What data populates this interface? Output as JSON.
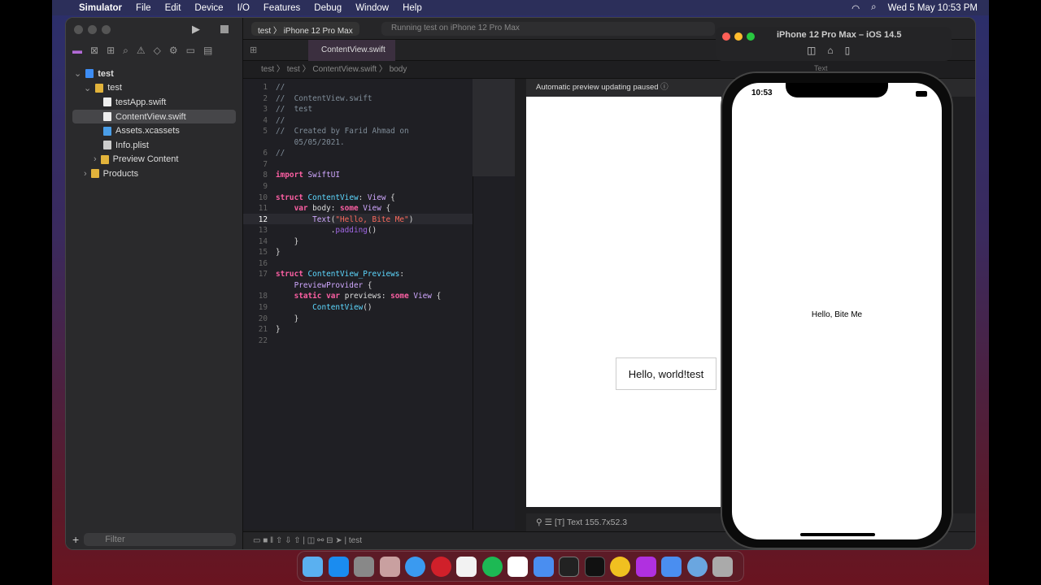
{
  "menubar": {
    "app": "Simulator",
    "items": [
      "File",
      "Edit",
      "Device",
      "I/O",
      "Features",
      "Debug",
      "Window",
      "Help"
    ],
    "datetime": "Wed 5 May  10:53 PM"
  },
  "toolbar": {
    "scheme": "test",
    "device": "iPhone 12 Pro Max",
    "status": "Running test on iPhone 12 Pro Max"
  },
  "navigator": {
    "items": [
      {
        "label": "test",
        "level": 0
      },
      {
        "label": "test",
        "level": 1
      },
      {
        "label": "testApp.swift",
        "level": 2
      },
      {
        "label": "ContentView.swift",
        "level": 2,
        "selected": true
      },
      {
        "label": "Assets.xcassets",
        "level": 2
      },
      {
        "label": "Info.plist",
        "level": 2
      },
      {
        "label": "Preview Content",
        "level": 2
      },
      {
        "label": "Products",
        "level": 1
      }
    ],
    "filter_placeholder": "Filter"
  },
  "tab": {
    "label": "ContentView.swift"
  },
  "jumpbar": [
    "test",
    "test",
    "ContentView.swift",
    "body"
  ],
  "code": [
    {
      "n": "1",
      "t": "//"
    },
    {
      "n": "2",
      "t": "//  ContentView.swift"
    },
    {
      "n": "3",
      "t": "//  test"
    },
    {
      "n": "4",
      "t": "//"
    },
    {
      "n": "5",
      "t": "//  Created by Farid Ahmad on"
    },
    {
      "n": "",
      "t": "    05/05/2021."
    },
    {
      "n": "6",
      "t": "//"
    },
    {
      "n": "7",
      "t": ""
    },
    {
      "n": "8",
      "t": "import SwiftUI"
    },
    {
      "n": "9",
      "t": ""
    },
    {
      "n": "10",
      "t": "struct ContentView: View {"
    },
    {
      "n": "11",
      "t": "    var body: some View {"
    },
    {
      "n": "12",
      "t": "        Text(\"Hello, Bite Me\")"
    },
    {
      "n": "13",
      "t": "            .padding()"
    },
    {
      "n": "14",
      "t": "    }"
    },
    {
      "n": "15",
      "t": "}"
    },
    {
      "n": "16",
      "t": ""
    },
    {
      "n": "17",
      "t": "struct ContentView_Previews:"
    },
    {
      "n": "",
      "t": "    PreviewProvider {"
    },
    {
      "n": "18",
      "t": "    static var previews: some View {"
    },
    {
      "n": "19",
      "t": "        ContentView()"
    },
    {
      "n": "20",
      "t": "    }"
    },
    {
      "n": "21",
      "t": "}"
    },
    {
      "n": "22",
      "t": ""
    }
  ],
  "preview": {
    "banner": "Automatic preview updating paused",
    "text": "Hello, world!test",
    "footer": "Text 155.7x52.3"
  },
  "debugbar": {
    "target": "test"
  },
  "simulator": {
    "title": "iPhone 12 Pro Max – iOS 14.5",
    "time": "10:53",
    "text": "Hello, Bite Me",
    "inspector_label": "Text"
  }
}
